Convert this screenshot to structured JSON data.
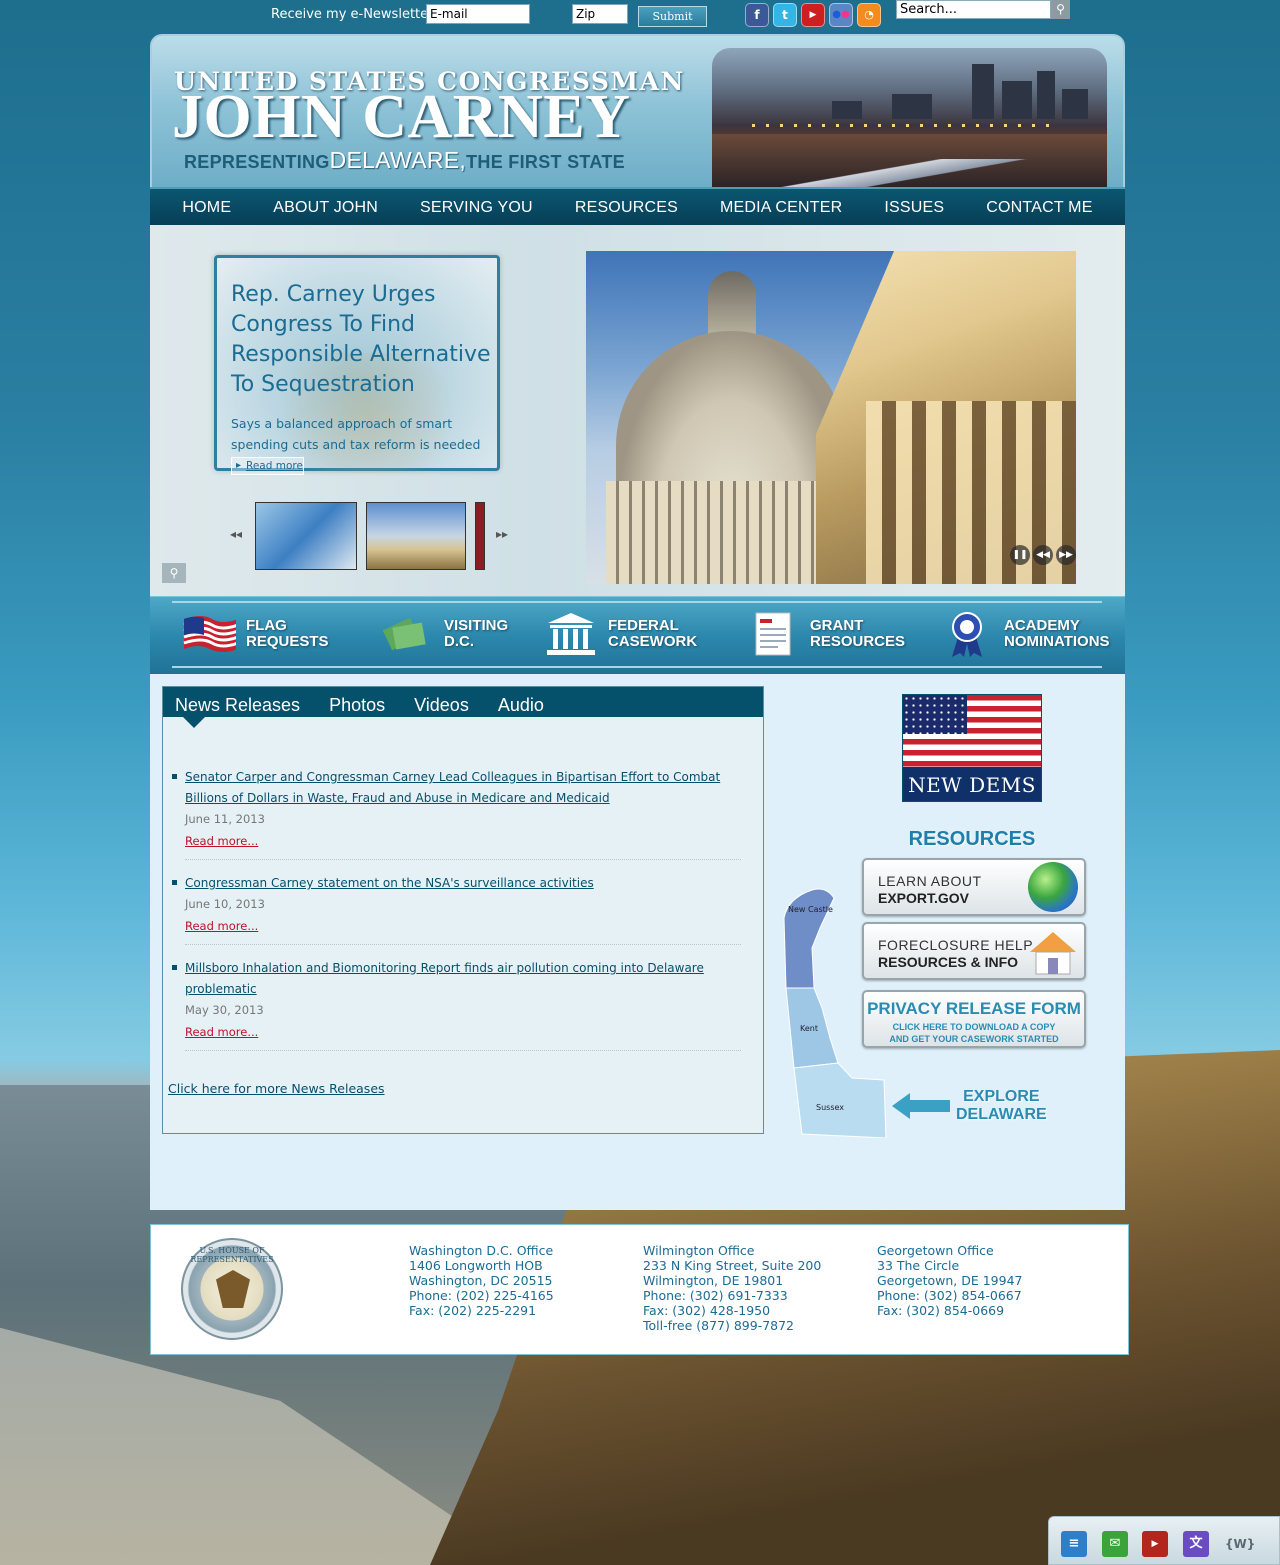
{
  "topbar": {
    "newsletter_label": "Receive my e-Newsletter!",
    "email_value": "E-mail",
    "zip_value": "Zip",
    "submit_label": "Submit",
    "search_value": "Search...",
    "social": [
      "facebook-icon",
      "twitter-icon",
      "youtube-icon",
      "flickr-icon",
      "rss-icon"
    ]
  },
  "header": {
    "kicker": "UNITED STATES CONGRESSMAN",
    "name": "JOHN CARNEY",
    "tag_pre": "REPRESENTING",
    "tag_state": "DELAWARE",
    "tag_comma": ",",
    "tag_post": "THE FIRST STATE"
  },
  "nav": {
    "items": [
      "HOME",
      "ABOUT JOHN",
      "SERVING YOU",
      "RESOURCES",
      "MEDIA CENTER",
      "ISSUES",
      "CONTACT ME"
    ]
  },
  "feature": {
    "title": "Rep. Carney Urges Congress To Find Responsible Alternative To Sequestration",
    "summary": "Says a balanced approach of smart spending cuts and tax reform is needed",
    "read_more": "Read more"
  },
  "quicklinks": [
    {
      "line1": "FLAG",
      "line2": "REQUESTS",
      "icon": "flag-icon"
    },
    {
      "line1": "VISITING",
      "line2": "D.C.",
      "icon": "tickets-icon"
    },
    {
      "line1": "FEDERAL",
      "line2": "CASEWORK",
      "icon": "building-icon"
    },
    {
      "line1": "GRANT",
      "line2": "RESOURCES",
      "icon": "document-icon"
    },
    {
      "line1": "ACADEMY",
      "line2": "NOMINATIONS",
      "icon": "ribbon-icon"
    }
  ],
  "news": {
    "tabs": [
      "News Releases",
      "Photos",
      "Videos",
      "Audio"
    ],
    "items": [
      {
        "title": "Senator Carper and Congressman Carney Lead Colleagues in Bipartisan Effort to Combat Billions of Dollars in Waste, Fraud and Abuse in Medicare and Medicaid",
        "date": "June 11, 2013",
        "more": "Read more..."
      },
      {
        "title": "Congressman Carney statement on the NSA's surveillance activities",
        "date": "June 10, 2013",
        "more": "Read more..."
      },
      {
        "title": "Millsboro Inhalation and Biomonitoring Report finds air pollution coming into Delaware problematic",
        "date": "May 30, 2013",
        "more": "Read more..."
      }
    ],
    "more_link": "Click here for more News Releases"
  },
  "sidebar": {
    "newdems_label": "NEW DEMS",
    "resources_title": "RESOURCES",
    "export_line1": "LEARN ABOUT",
    "export_line2": "EXPORT.GOV",
    "foreclosure_line1": "FORECLOSURE HELP",
    "foreclosure_line2": "RESOURCES & INFO",
    "privacy_title": "PRIVACY RELEASE FORM",
    "privacy_line1": "CLICK HERE TO DOWNLOAD A COPY",
    "privacy_line2": "AND GET YOUR CASEWORK STARTED",
    "map_counties": [
      "New Castle",
      "Kent",
      "Sussex"
    ],
    "explore_line1": "EXPLORE",
    "explore_line2": "DELAWARE"
  },
  "footer": {
    "seal_text": "U.S. HOUSE OF REPRESENTATIVES",
    "offices": [
      {
        "lines": [
          "Washington D.C. Office",
          "1406 Longworth HOB",
          "Washington, DC 20515",
          "Phone: (202) 225-4165",
          "Fax: (202) 225-2291"
        ]
      },
      {
        "lines": [
          "Wilmington Office",
          "233 N King Street, Suite 200",
          "Wilmington, DE 19801",
          "Phone: (302) 691-7333",
          "Fax: (302) 428-1950",
          "Toll-free (877) 899-7872"
        ]
      },
      {
        "lines": [
          "Georgetown Office",
          "33 The Circle",
          "Georgetown, DE 19947",
          "Phone: (302) 854-0667",
          "Fax: (302) 854-0669"
        ]
      }
    ]
  },
  "sharebar": {
    "icons": [
      "twitter-share-icon",
      "email-share-icon",
      "youtube-share-icon",
      "translate-icon",
      "widget-icon"
    ],
    "widget_label": "{W}"
  }
}
